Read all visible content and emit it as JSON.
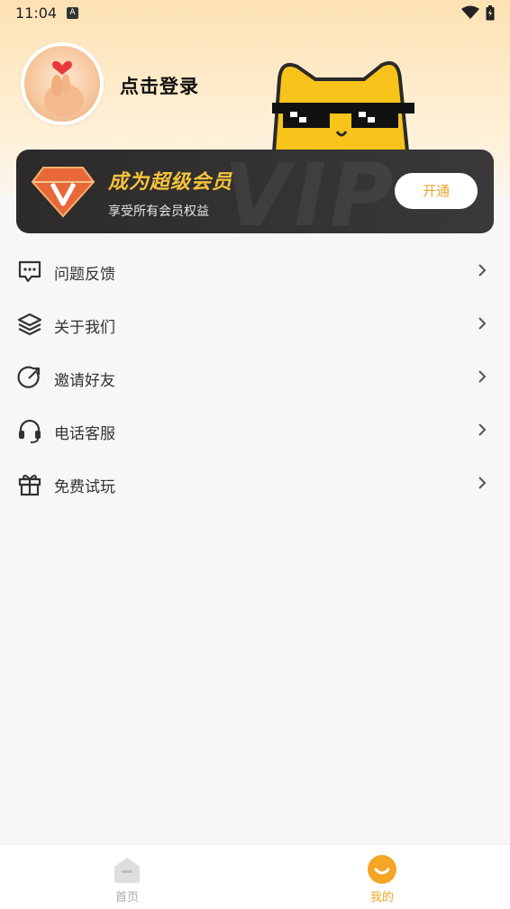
{
  "status_bar": {
    "time": "11:04",
    "notification_badge": "A"
  },
  "profile": {
    "login_text": "点击登录"
  },
  "vip": {
    "watermark": "VIP",
    "title": "成为超级会员",
    "subtitle": "享受所有会员权益",
    "button_label": "开通",
    "accent_color": "#f6c23c"
  },
  "menu": [
    {
      "label": "问题反馈",
      "icon": "feedback-icon"
    },
    {
      "label": "关于我们",
      "icon": "layers-icon"
    },
    {
      "label": "邀请好友",
      "icon": "share-arrow-icon"
    },
    {
      "label": "电话客服",
      "icon": "headset-icon"
    },
    {
      "label": "免费试玩",
      "icon": "gift-icon"
    }
  ],
  "bottom_nav": {
    "items": [
      {
        "label": "首页",
        "icon": "home-icon",
        "active": false
      },
      {
        "label": "我的",
        "icon": "smile-icon",
        "active": true
      }
    ],
    "active_color": "#f0a529"
  }
}
